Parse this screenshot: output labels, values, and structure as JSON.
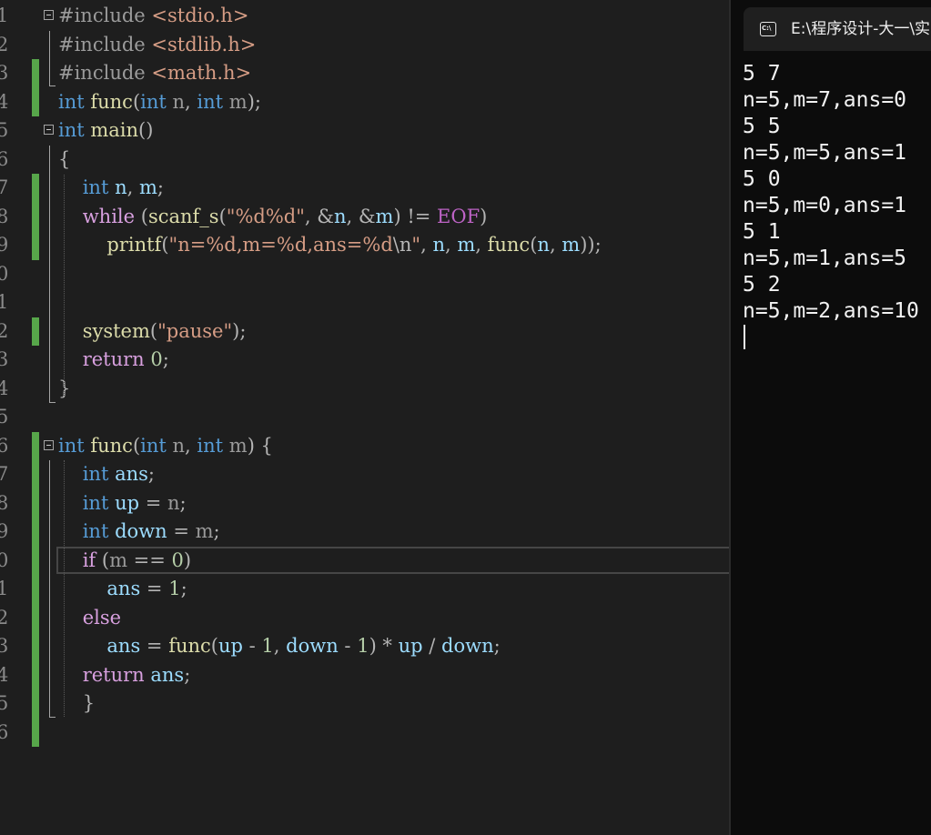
{
  "editor": {
    "line_numbers": [
      "1",
      "2",
      "3",
      "4",
      "5",
      "6",
      "7",
      "8",
      "9",
      "0",
      "1",
      "2",
      "3",
      "4",
      "5",
      "6",
      "7",
      "8",
      "9",
      "0",
      "1",
      "2",
      "3",
      "4",
      "5",
      "6"
    ],
    "lines": [
      [
        [
          "pp",
          "#include "
        ],
        [
          "inc",
          "<stdio.h>"
        ]
      ],
      [
        [
          "pp",
          "#include "
        ],
        [
          "inc",
          "<stdlib.h>"
        ]
      ],
      [
        [
          "pp",
          "#include "
        ],
        [
          "inc",
          "<math.h>"
        ]
      ],
      [
        [
          "kw",
          "int "
        ],
        [
          "fn",
          "func"
        ],
        [
          "op",
          "("
        ],
        [
          "kw",
          "int "
        ],
        [
          "prm",
          "n"
        ],
        [
          "op",
          ", "
        ],
        [
          "kw",
          "int "
        ],
        [
          "prm",
          "m"
        ],
        [
          "op",
          ");"
        ]
      ],
      [
        [
          "kw",
          "int "
        ],
        [
          "fn",
          "main"
        ],
        [
          "op",
          "()"
        ]
      ],
      [
        [
          "op",
          "{"
        ]
      ],
      [
        [
          "op",
          "    "
        ],
        [
          "kw",
          "int "
        ],
        [
          "var",
          "n"
        ],
        [
          "op",
          ", "
        ],
        [
          "var",
          "m"
        ],
        [
          "op",
          ";"
        ]
      ],
      [
        [
          "op",
          "    "
        ],
        [
          "ctl",
          "while "
        ],
        [
          "op",
          "("
        ],
        [
          "fn",
          "scanf_s"
        ],
        [
          "op",
          "("
        ],
        [
          "str",
          "\"%d%d\""
        ],
        [
          "op",
          ", &"
        ],
        [
          "var",
          "n"
        ],
        [
          "op",
          ", &"
        ],
        [
          "var",
          "m"
        ],
        [
          "op",
          ") != "
        ],
        [
          "mac",
          "EOF"
        ],
        [
          "op",
          ")"
        ]
      ],
      [
        [
          "op",
          "        "
        ],
        [
          "fn",
          "printf"
        ],
        [
          "op",
          "("
        ],
        [
          "str",
          "\"n=%d,m=%d,ans=%d"
        ],
        [
          "esc",
          "\\n"
        ],
        [
          "str",
          "\""
        ],
        [
          "op",
          ", "
        ],
        [
          "var",
          "n"
        ],
        [
          "op",
          ", "
        ],
        [
          "var",
          "m"
        ],
        [
          "op",
          ", "
        ],
        [
          "fn",
          "func"
        ],
        [
          "op",
          "("
        ],
        [
          "var",
          "n"
        ],
        [
          "op",
          ", "
        ],
        [
          "var",
          "m"
        ],
        [
          "op",
          "));"
        ]
      ],
      [],
      [],
      [
        [
          "op",
          "    "
        ],
        [
          "fn",
          "system"
        ],
        [
          "op",
          "("
        ],
        [
          "str",
          "\"pause\""
        ],
        [
          "op",
          ");"
        ]
      ],
      [
        [
          "op",
          "    "
        ],
        [
          "ctl",
          "return "
        ],
        [
          "num",
          "0"
        ],
        [
          "op",
          ";"
        ]
      ],
      [
        [
          "op",
          "}"
        ]
      ],
      [],
      [
        [
          "kw",
          "int "
        ],
        [
          "fn",
          "func"
        ],
        [
          "op",
          "("
        ],
        [
          "kw",
          "int "
        ],
        [
          "prm",
          "n"
        ],
        [
          "op",
          ", "
        ],
        [
          "kw",
          "int "
        ],
        [
          "prm",
          "m"
        ],
        [
          "op",
          ") {"
        ]
      ],
      [
        [
          "op",
          "    "
        ],
        [
          "kw",
          "int "
        ],
        [
          "var",
          "ans"
        ],
        [
          "op",
          ";"
        ]
      ],
      [
        [
          "op",
          "    "
        ],
        [
          "kw",
          "int "
        ],
        [
          "var",
          "up"
        ],
        [
          "op",
          " = "
        ],
        [
          "prm",
          "n"
        ],
        [
          "op",
          ";"
        ]
      ],
      [
        [
          "op",
          "    "
        ],
        [
          "kw",
          "int "
        ],
        [
          "var",
          "down"
        ],
        [
          "op",
          " = "
        ],
        [
          "prm",
          "m"
        ],
        [
          "op",
          ";"
        ]
      ],
      [
        [
          "op",
          "    "
        ],
        [
          "ctl",
          "if "
        ],
        [
          "op",
          "("
        ],
        [
          "prm",
          "m"
        ],
        [
          "op",
          " == "
        ],
        [
          "num",
          "0"
        ],
        [
          "op",
          ")"
        ]
      ],
      [
        [
          "op",
          "        "
        ],
        [
          "var",
          "ans"
        ],
        [
          "op",
          " = "
        ],
        [
          "num",
          "1"
        ],
        [
          "op",
          ";"
        ]
      ],
      [
        [
          "op",
          "    "
        ],
        [
          "ctl",
          "else"
        ]
      ],
      [
        [
          "op",
          "        "
        ],
        [
          "var",
          "ans"
        ],
        [
          "op",
          " = "
        ],
        [
          "fn",
          "func"
        ],
        [
          "op",
          "("
        ],
        [
          "var",
          "up"
        ],
        [
          "op",
          " - "
        ],
        [
          "num",
          "1"
        ],
        [
          "op",
          ", "
        ],
        [
          "var",
          "down"
        ],
        [
          "op",
          " - "
        ],
        [
          "num",
          "1"
        ],
        [
          "op",
          ") * "
        ],
        [
          "var",
          "up"
        ],
        [
          "op",
          " / "
        ],
        [
          "var",
          "down"
        ],
        [
          "op",
          ";"
        ]
      ],
      [
        [
          "op",
          "    "
        ],
        [
          "ctl",
          "return "
        ],
        [
          "var",
          "ans"
        ],
        [
          "op",
          ";"
        ]
      ],
      [
        [
          "op",
          "    }"
        ]
      ],
      []
    ]
  },
  "terminal": {
    "title": "E:\\程序设计-大一\\实",
    "icon_label": "C:\\",
    "output": [
      "5 7",
      "n=5,m=7,ans=0",
      "5 5",
      "n=5,m=5,ans=1",
      "5 0",
      "n=5,m=0,ans=1",
      "5 1",
      "n=5,m=1,ans=5",
      "5 2",
      "n=5,m=2,ans=10"
    ]
  }
}
